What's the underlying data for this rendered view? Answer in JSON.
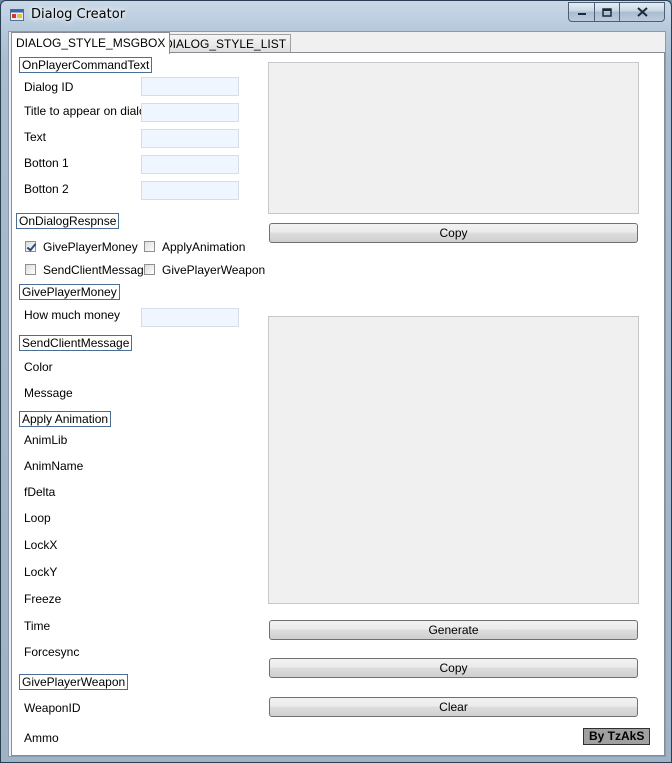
{
  "window": {
    "title": "Dialog Creator"
  },
  "tabs": [
    {
      "label": "DIALOG_STYLE_MSGBOX",
      "active": true
    },
    {
      "label": "DIALOG_STYLE_LIST",
      "active": false
    }
  ],
  "groups": {
    "on_player_command_text": {
      "title": "OnPlayerCommandText",
      "fields": [
        {
          "label": "Dialog ID",
          "value": ""
        },
        {
          "label": "Title to appear on dialog",
          "value": ""
        },
        {
          "label": "Text",
          "value": ""
        },
        {
          "label": "Botton 1",
          "value": ""
        },
        {
          "label": "Botton 2",
          "value": ""
        }
      ]
    },
    "on_dialog_response": {
      "title": "OnDialogRespnse",
      "checkboxes": [
        {
          "label": "GivePlayerMoney",
          "checked": true
        },
        {
          "label": "ApplyAnimation",
          "checked": false
        },
        {
          "label": "SendClientMessage",
          "checked": false
        },
        {
          "label": "GivePlayerWeapon",
          "checked": false
        }
      ]
    },
    "give_player_money": {
      "title": "GivePlayerMoney",
      "fields": [
        {
          "label": "How much money",
          "value": ""
        }
      ]
    },
    "send_client_message": {
      "title": "SendClientMessage",
      "fields": [
        {
          "label": "Color"
        },
        {
          "label": "Message"
        }
      ]
    },
    "apply_animation": {
      "title": "Apply Animation",
      "fields": [
        {
          "label": "AnimLib"
        },
        {
          "label": "AnimName"
        },
        {
          "label": "fDelta"
        },
        {
          "label": "Loop"
        },
        {
          "label": "LockX"
        },
        {
          "label": "LockY"
        },
        {
          "label": "Freeze"
        },
        {
          "label": "Time"
        },
        {
          "label": "Forcesync"
        }
      ]
    },
    "give_player_weapon": {
      "title": "GivePlayerWeapon",
      "fields": [
        {
          "label": "WeaponID"
        },
        {
          "label": "Ammo"
        }
      ]
    }
  },
  "output": {
    "top_text": "",
    "bottom_text": "",
    "copy_label_top": "Copy",
    "generate_label": "Generate",
    "copy_label_bottom": "Copy",
    "clear_label": "Clear"
  },
  "credit": "By TzAkS",
  "colors": {
    "input_bg": "#f0f6ff",
    "group_border": "#4a6f96",
    "tab_border": "#898c95"
  }
}
